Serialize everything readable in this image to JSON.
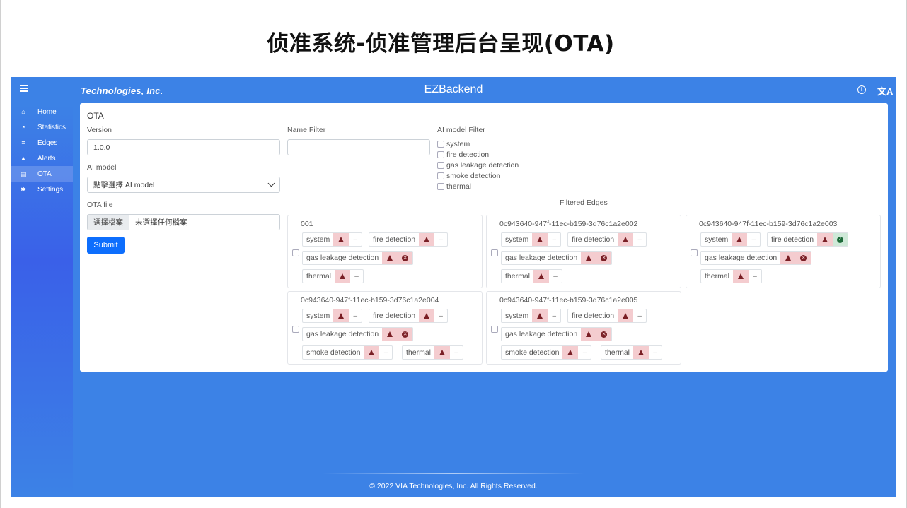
{
  "slide": {
    "title": "侦准系统-侦准管理后台呈现(OTA)"
  },
  "topbar": {
    "brand": "Technologies, Inc.",
    "title": "EZBackend",
    "info_icon": "info-icon",
    "lang_icon": "translate-icon",
    "lang_glyph": "文A"
  },
  "sidebar": {
    "items": [
      {
        "label": "Home",
        "icon": "home-icon",
        "glyph": "⌂"
      },
      {
        "label": "Statistics",
        "icon": "chart-icon",
        "glyph": "◔"
      },
      {
        "label": "Edges",
        "icon": "server-icon",
        "glyph": "≡"
      },
      {
        "label": "Alerts",
        "icon": "bell-icon",
        "glyph": "▲"
      },
      {
        "label": "OTA",
        "icon": "file-icon",
        "glyph": "▤"
      },
      {
        "label": "Settings",
        "icon": "gear-icon",
        "glyph": "✱"
      }
    ],
    "active": "OTA"
  },
  "ota": {
    "title": "OTA",
    "version_label": "Version",
    "version_value": "1.0.0",
    "ai_model_label": "AI model",
    "ai_model_value": "點擊選擇 AI model",
    "ota_file_label": "OTA file",
    "file_button": "選擇檔案",
    "file_status": "未選擇任何檔案",
    "submit": "Submit",
    "name_filter_label": "Name Filter",
    "name_filter_value": "",
    "model_filter_label": "AI model Filter",
    "model_filters": [
      "system",
      "fire detection",
      "gas leakage detection",
      "smoke detection",
      "thermal"
    ],
    "filtered_title": "Filtered Edges"
  },
  "edges": [
    {
      "name": "001",
      "tags": [
        "system",
        "fire detection",
        "gas leakage detection",
        "thermal"
      ]
    },
    {
      "name": "0c943640-947f-11ec-b159-3d76c1a2e002",
      "tags": [
        "system",
        "fire detection",
        "gas leakage detection",
        "thermal"
      ]
    },
    {
      "name": "0c943640-947f-11ec-b159-3d76c1a2e003",
      "tags": [
        "system",
        "fire detection",
        "gas leakage detection",
        "thermal"
      ]
    },
    {
      "name": "0c943640-947f-11ec-b159-3d76c1a2e004",
      "tags": [
        "system",
        "fire detection",
        "gas leakage detection",
        "smoke detection",
        "thermal"
      ]
    },
    {
      "name": "0c943640-947f-11ec-b159-3d76c1a2e005",
      "tags": [
        "system",
        "fire detection",
        "gas leakage detection",
        "smoke detection",
        "thermal"
      ]
    }
  ],
  "status_colors": {
    "warning": "#f4cccf",
    "ok": "#cfe9d8",
    "primary": "#0d6efd",
    "app_bg": "#3c82e6"
  },
  "footer": "© 2022 VIA Technologies, Inc. All Rights Reserved."
}
